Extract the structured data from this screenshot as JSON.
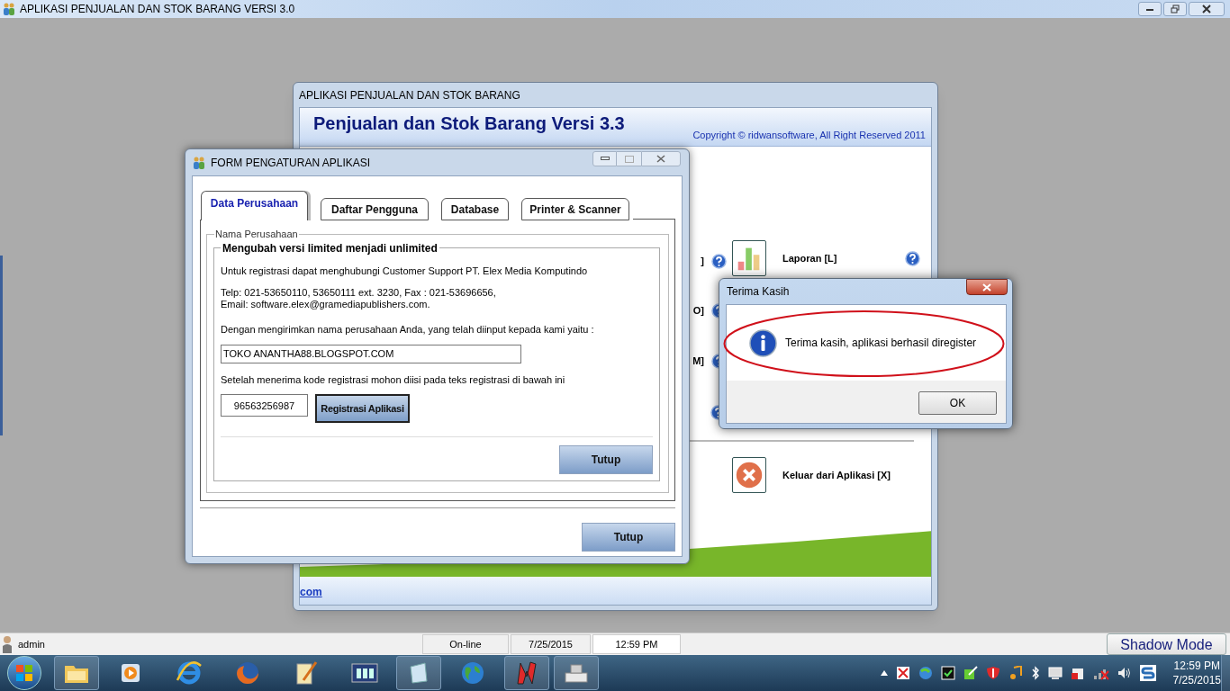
{
  "app": {
    "title": "APLIKASI PENJUALAN DAN STOK BARANG VERSI 3.0"
  },
  "main_window": {
    "title": "APLIKASI PENJUALAN DAN STOK BARANG",
    "heading": "Penjualan dan Stok Barang Versi 3.3",
    "copyright": "Copyright © ridwansoftware, All Right Reserved 2011",
    "menu_fragments": [
      "]",
      "O]",
      "M]"
    ],
    "menu_items": [
      {
        "label": "Laporan [L]",
        "kind": "report"
      },
      {
        "label": "Keluar dari Aplikasi [X]",
        "kind": "exit"
      }
    ],
    "footer_link": "com"
  },
  "settings_window": {
    "title": "FORM PENGATURAN APLIKASI",
    "tabs": [
      {
        "label": "Data Perusahaan",
        "selected": true
      },
      {
        "label": "Daftar Pengguna",
        "selected": false
      },
      {
        "label": "Database",
        "selected": false
      },
      {
        "label": "Printer & Scanner",
        "selected": false
      }
    ],
    "group_label": "Nama Perusahaan",
    "section_title": "Mengubah versi limited menjadi unlimited",
    "info": "Untuk registrasi dapat menghubungi Customer Support PT. Elex Media Komputindo",
    "phone": "Telp: 021-53650110, 53650111 ext. 3230, Fax : 021-53696656,",
    "email": "Email: software.elex@gramediapublishers.com.",
    "prompt": "Dengan mengirimkan nama perusahaan Anda, yang telah diinput kepada kami yaitu :",
    "company_name": "TOKO ANANTHA88.BLOGSPOT.COM",
    "code_prompt": "Setelah menerima kode registrasi mohon diisi pada teks registrasi di bawah ini",
    "registration_code": "96563256987",
    "register_button": "Registrasi Aplikasi",
    "inner_close_button": "Tutup",
    "close_button": "Tutup"
  },
  "dialog": {
    "title": "Terima Kasih",
    "message": "Terima kasih, aplikasi berhasil diregister",
    "button": "OK",
    "highlighted": true
  },
  "status_bar": {
    "user": "admin",
    "connection": "On-line",
    "date": "7/25/2015",
    "time": "12:59 PM",
    "mode_button": "Shadow Mode"
  },
  "taskbar": {
    "clock_time": "12:59 PM",
    "clock_date": "7/25/2015"
  }
}
